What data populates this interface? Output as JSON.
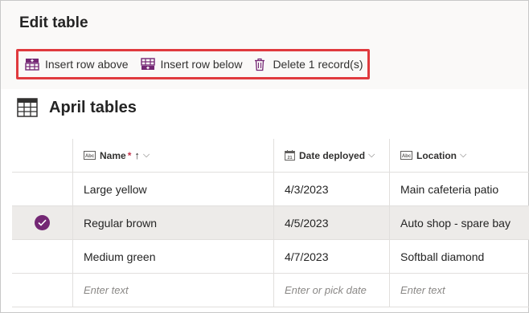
{
  "header": {
    "title": "Edit table"
  },
  "toolbar": {
    "insert_above_label": "Insert row above",
    "insert_below_label": "Insert row below",
    "delete_label": "Delete 1 record(s)"
  },
  "table": {
    "name": "April tables",
    "columns": [
      {
        "label": "Name",
        "required": "*",
        "sort": "↑",
        "icon": "text-column-icon"
      },
      {
        "label": "Date deployed",
        "icon": "calendar-icon"
      },
      {
        "label": "Location",
        "icon": "text-column-icon"
      }
    ],
    "rows": [
      {
        "name": "Large yellow",
        "date": "4/3/2023",
        "location": "Main cafeteria patio",
        "selected": false
      },
      {
        "name": "Regular brown",
        "date": "4/5/2023",
        "location": "Auto shop - spare bay",
        "selected": true
      },
      {
        "name": "Medium green",
        "date": "4/7/2023",
        "location": "Softball diamond",
        "selected": false
      }
    ],
    "new_row": {
      "name_placeholder": "Enter text",
      "date_placeholder": "Enter or pick date",
      "location_placeholder": "Enter text"
    }
  },
  "colors": {
    "accent": "#742774",
    "highlight_border": "#e03a3e",
    "selected_row": "#edebe9"
  }
}
